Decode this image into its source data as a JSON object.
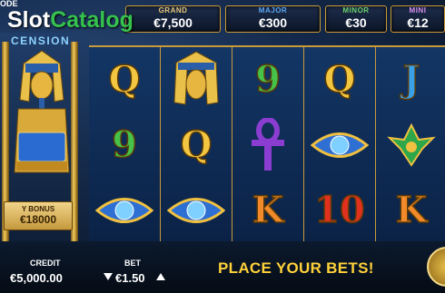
{
  "game": {
    "mode_fragment": "ODE",
    "title_fragment": "CENSION",
    "watermark_part1": "Slot",
    "watermark_part2": "Catalog"
  },
  "jackpots": [
    {
      "label": "GRAND",
      "value": "€7,500",
      "color": "#e7c878"
    },
    {
      "label": "MAJOR",
      "value": "€300",
      "color": "#5aa6f0"
    },
    {
      "label": "MINOR",
      "value": "€30",
      "color": "#6bd06b"
    },
    {
      "label": "MINI",
      "value": "€12",
      "color": "#d690f0"
    }
  ],
  "side_panel": {
    "bonus_label": "Y BONUS",
    "bonus_value": "€18000"
  },
  "reels": [
    [
      "Q",
      "9",
      "blue-eye-gem"
    ],
    [
      "pharaoh-mask",
      "Q",
      "blue-eye-gem"
    ],
    [
      "9",
      "purple-ankh",
      "K"
    ],
    [
      "Q",
      "blue-eye-gem",
      "10"
    ],
    [
      "J",
      "green-scarab-emblem",
      "K"
    ]
  ],
  "bottom_bar": {
    "credit_label": "CREDIT",
    "credit_value": "€5,000.00",
    "bet_label": "BET",
    "bet_value": "€1.50",
    "bet_down_icon": "triangle-down-icon",
    "bet_up_icon": "triangle-up-icon",
    "message": "PLACE YOUR BETS!"
  }
}
